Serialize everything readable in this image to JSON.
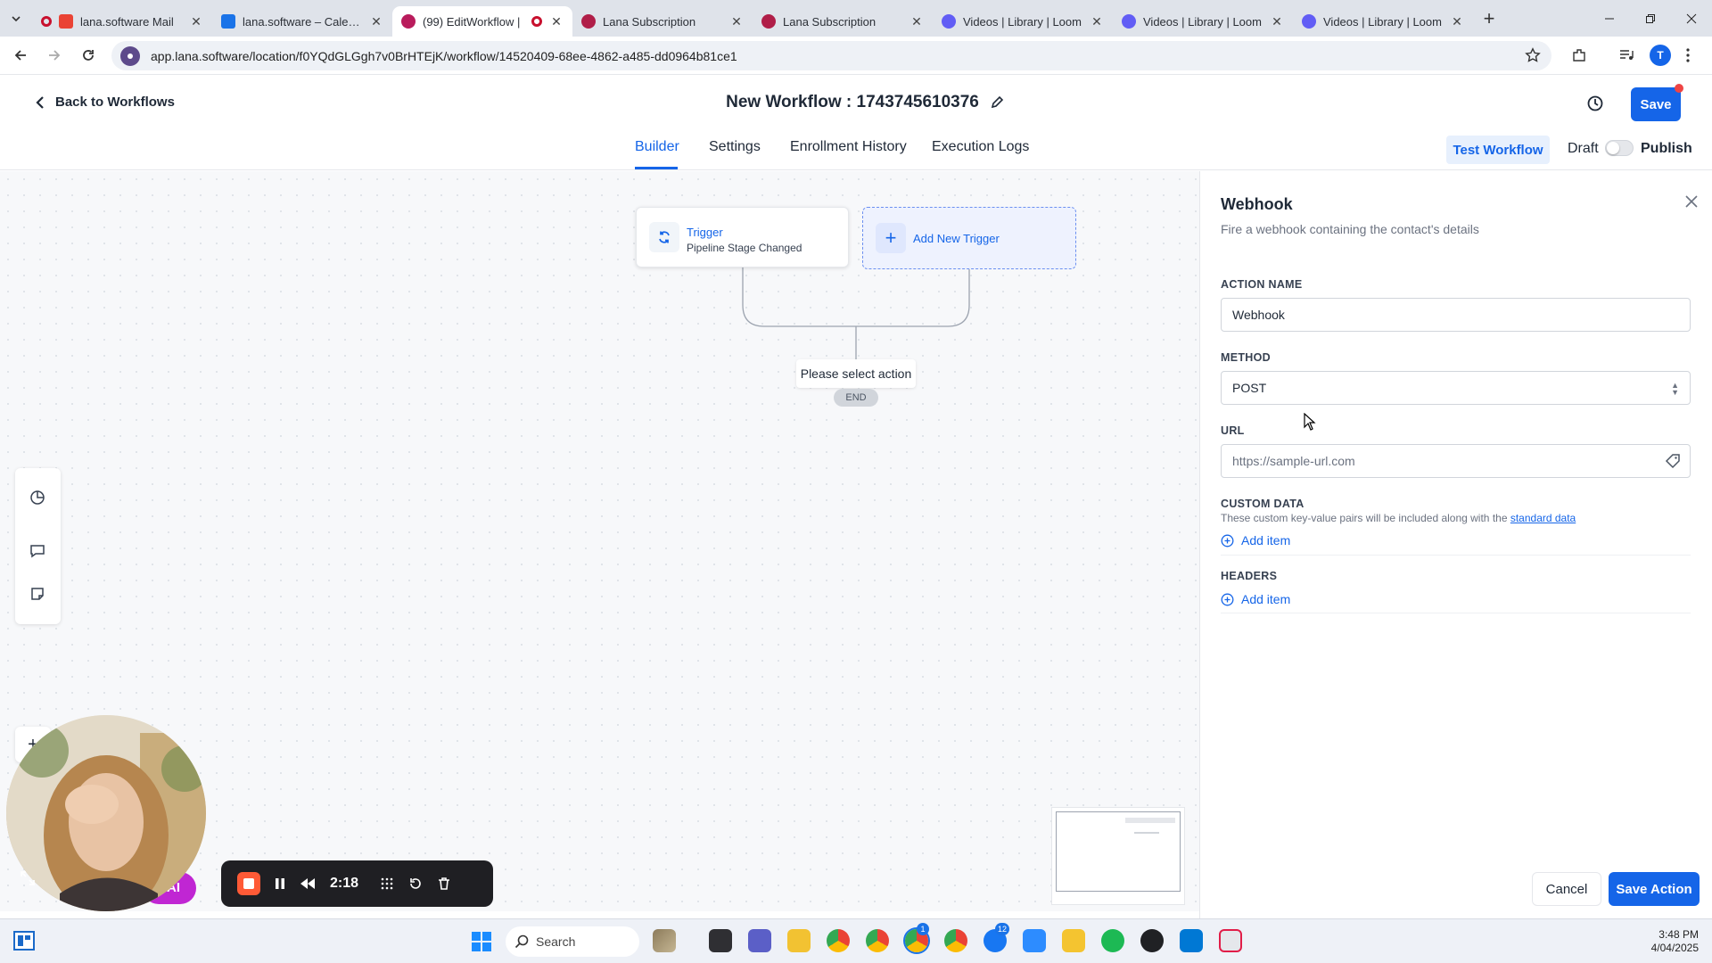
{
  "browser": {
    "tabs": [
      {
        "title": "lana.software Mail",
        "favicon_color": "#ea4335"
      },
      {
        "title": "lana.software – Calendar",
        "favicon_color": "#1a73e8"
      },
      {
        "title": "(99) EditWorkflow |",
        "favicon_color": "#b91c5c",
        "active": true
      },
      {
        "title": "Lana Subscription",
        "favicon_color": "#b01e48"
      },
      {
        "title": "Lana Subscription",
        "favicon_color": "#b01e48"
      },
      {
        "title": "Videos | Library | Loom",
        "favicon_color": "#625df5"
      },
      {
        "title": "Videos | Library | Loom",
        "favicon_color": "#625df5"
      },
      {
        "title": "Videos | Library | Loom",
        "favicon_color": "#625df5"
      }
    ],
    "url": "app.lana.software/location/f0YQdGLGgh7v0BrHTEjK/workflow/14520409-68ee-4862-a485-dd0964b81ce1",
    "profile_initial": "T"
  },
  "header": {
    "back_label": "Back to Workflows",
    "workflow_title": "New Workflow : 1743745610376",
    "save_label": "Save"
  },
  "tabs": {
    "items": [
      "Builder",
      "Settings",
      "Enrollment History",
      "Execution Logs"
    ],
    "active": "Builder",
    "test_workflow_label": "Test Workflow",
    "draft_label": "Draft",
    "publish_label": "Publish",
    "publish_enabled": false
  },
  "canvas": {
    "trigger_title": "Trigger",
    "trigger_subtitle": "Pipeline Stage Changed",
    "add_trigger_label": "Add New Trigger",
    "select_action_label": "Please select action",
    "end_label": "END"
  },
  "recorder": {
    "time": "2:18",
    "ai_label": "AI"
  },
  "panel": {
    "title": "Webhook",
    "subtitle": "Fire a webhook containing the contact's details",
    "action_name_label": "ACTION NAME",
    "action_name_value": "Webhook",
    "method_label": "METHOD",
    "method_value": "POST",
    "url_label": "URL",
    "url_placeholder": "https://sample-url.com",
    "custom_data_label": "CUSTOM DATA",
    "custom_data_help": "These custom key-value pairs will be included along with the",
    "custom_data_link": "standard data",
    "add_item_label": "Add item",
    "headers_label": "HEADERS",
    "cancel_label": "Cancel",
    "save_action_label": "Save Action"
  },
  "taskbar": {
    "search_label": "Search",
    "time": "3:48 PM",
    "date": "4/04/2025",
    "badges": {
      "messenger": "12",
      "chrome": "1"
    }
  },
  "colors": {
    "accent": "#1565e8",
    "recorder_stop": "#ff5a36",
    "ai_button": "#c026d3"
  }
}
